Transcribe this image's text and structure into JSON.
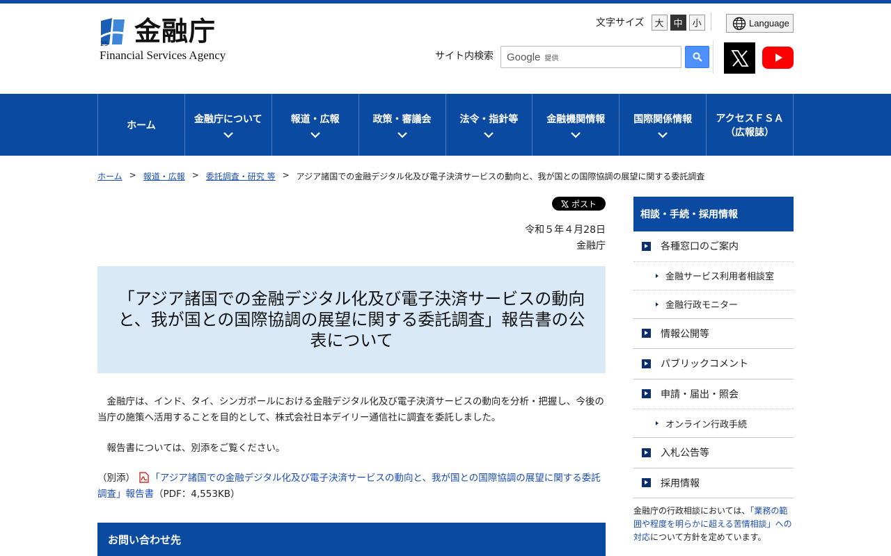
{
  "header": {
    "logo_jp": "金融庁",
    "logo_en": "Financial Services Agency",
    "fontsize_label": "文字サイズ",
    "fontsize_options": [
      "大",
      "中",
      "小"
    ],
    "language_label": "Language",
    "search_label": "サイト内検索",
    "search_brand": "Google",
    "search_brand_suffix": "提供"
  },
  "nav": {
    "items": [
      {
        "label": "ホーム",
        "label2": ""
      },
      {
        "label": "金融庁について",
        "label2": ""
      },
      {
        "label": "報道・広報",
        "label2": ""
      },
      {
        "label": "政策・審議会",
        "label2": ""
      },
      {
        "label": "法令・指針等",
        "label2": ""
      },
      {
        "label": "金融機関情報",
        "label2": ""
      },
      {
        "label": "国際関係情報",
        "label2": ""
      },
      {
        "label": "アクセスＦＳＡ",
        "label2": "（広報誌）"
      }
    ]
  },
  "breadcrumb": {
    "items": [
      "ホーム",
      "報道・広報",
      "委託調査・研究 等"
    ],
    "current": "アジア諸国での金融デジタル化及び電子決済サービスの動向と、我が国との国際協調の展望に関する委託調査",
    "separator": ">"
  },
  "main": {
    "post_label": "ポスト",
    "date": "令和５年４月28日",
    "issuer": "金融庁",
    "title": "「アジア諸国での金融デジタル化及び電子決済サービスの動向と、我が国との国際協調の展望に関する委託調査」報告書の公表について",
    "paragraph1": "　金融庁は、インド、タイ、シンガポールにおける金融デジタル化及び電子決済サービスの動向を分析・把握し、今後の当庁の施策へ活用することを目的として、株式会社日本デイリー通信社に調査を委託しました。",
    "paragraph2": "　報告書については、別添をご覧ください。",
    "attachment_prefix": "（別添）",
    "attachment_link": "「アジア諸国での金融デジタル化及び電子決済サービスの動向と、我が国との国際協調の展望に関する委託調査」報告書",
    "attachment_size": "（PDF：4,553KB）",
    "contact_heading": "お問い合わせ先"
  },
  "sidebar": {
    "heading": "相談・手続・採用情報",
    "items": [
      {
        "label": "各種窓口のご案内",
        "type": "main"
      },
      {
        "label": "金融サービス利用者相談室",
        "type": "sub"
      },
      {
        "label": "金融行政モニター",
        "type": "sub"
      },
      {
        "label": "情報公開等",
        "type": "main"
      },
      {
        "label": "パブリックコメント",
        "type": "main"
      },
      {
        "label": "申請・届出・照会",
        "type": "main"
      },
      {
        "label": "オンライン行政手続",
        "type": "sub"
      },
      {
        "label": "入札公告等",
        "type": "main"
      },
      {
        "label": "採用情報",
        "type": "main"
      }
    ],
    "note_prefix": "金融庁の行政相談においては、",
    "note_link": "「業務の範囲や程度を明らかに超える苦情相談」への対応",
    "note_suffix": "について方針を定めています。"
  },
  "colors": {
    "brand_blue": "#0b4aa1",
    "title_bg": "#d9e9f7",
    "link": "#1a4db3"
  }
}
